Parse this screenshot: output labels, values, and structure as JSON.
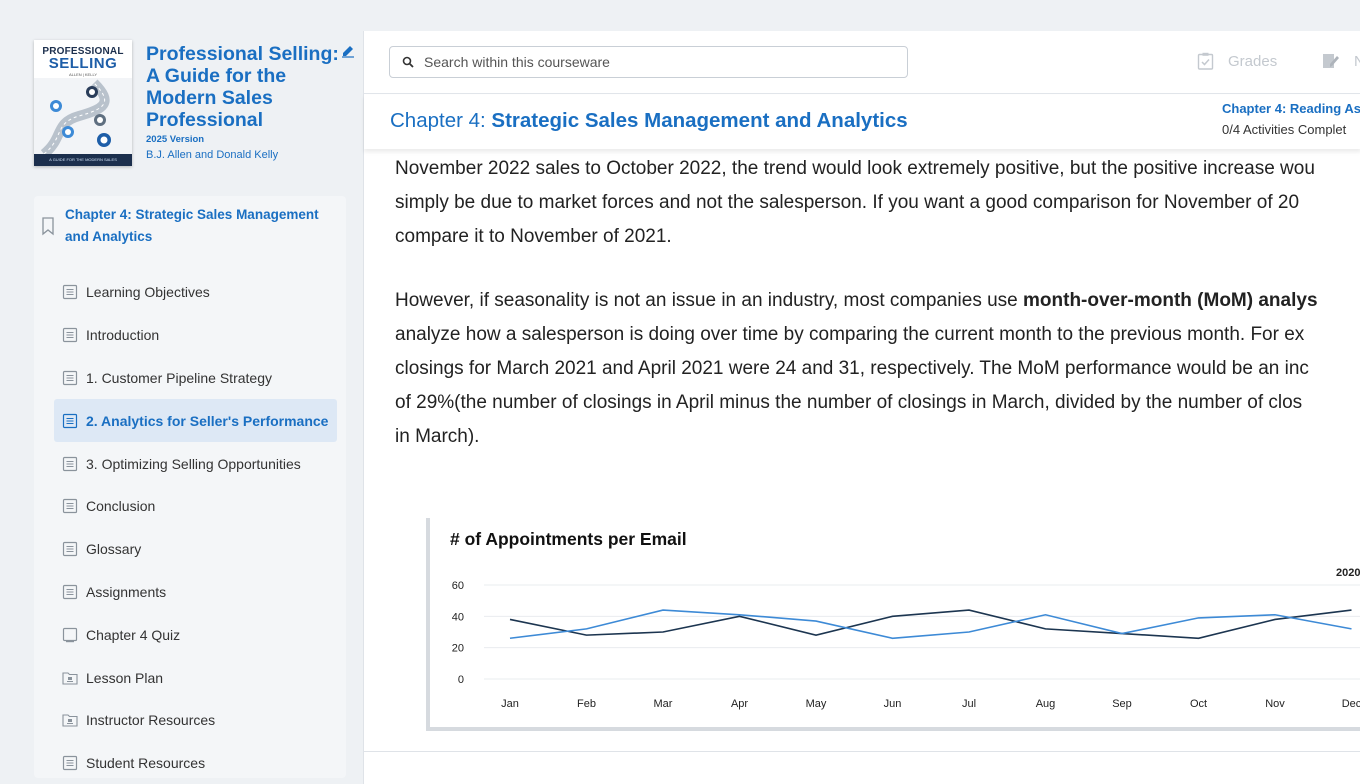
{
  "book": {
    "cover_title_line1": "PROFESSIONAL",
    "cover_title_line2": "SELLING",
    "cover_authors": "ALLEN | KELLY",
    "cover_band": "A GUIDE FOR THE MODERN SALES PROFESSIONAL",
    "title": "Professional Selling: A Guide for the Modern Sales Professional",
    "version": "2025 Version",
    "authors": "B.J. Allen and Donald Kelly",
    "edit_icon": "edit-pencil-icon"
  },
  "toc": {
    "chapter_title": "Chapter 4: Strategic Sales Management and Analytics",
    "items": [
      {
        "label": "Learning Objectives",
        "icon": "page-icon"
      },
      {
        "label": "Introduction",
        "icon": "page-icon"
      },
      {
        "label": "1. Customer Pipeline Strategy",
        "icon": "page-icon"
      },
      {
        "label": "2. Analytics for Seller's Performance",
        "icon": "page-icon",
        "active": true
      },
      {
        "label": "3. Optimizing Selling Opportunities",
        "icon": "page-icon"
      },
      {
        "label": "Conclusion",
        "icon": "page-icon"
      },
      {
        "label": "Glossary",
        "icon": "page-icon"
      },
      {
        "label": "Assignments",
        "icon": "page-icon"
      },
      {
        "label": "Chapter 4 Quiz",
        "icon": "quiz-icon"
      },
      {
        "label": "Lesson Plan",
        "icon": "folder-icon"
      },
      {
        "label": "Instructor Resources",
        "icon": "folder-icon"
      },
      {
        "label": "Student Resources",
        "icon": "page-icon"
      }
    ]
  },
  "search": {
    "placeholder": "Search within this courseware",
    "value": ""
  },
  "toolbar": {
    "grades_label": "Grades",
    "notes_label": "No"
  },
  "chapter": {
    "prefix": "Chapter 4: ",
    "title": "Strategic Sales Management and Analytics",
    "reading_title": "Chapter 4: Reading As",
    "reading_progress": "0/4 Activities Complet"
  },
  "content": {
    "p1_line1": "November 2022 sales to October 2022, the trend would look extremely positive, but the positive increase wou",
    "p1_line2": "simply be due to market forces and not the salesperson. If you want a good comparison for November of 20",
    "p1_line3": "compare it to November of 2021.",
    "p2_line1_a": "However, if seasonality is not an issue in an industry, most companies use ",
    "p2_line1_b": "month-over-month (MoM) analys",
    "p2_line2": "analyze how a salesperson is doing over time by comparing the current month to the previous month. For ex",
    "p2_line3": "closings for March 2021 and April 2021 were 24 and 31, respectively. The MoM performance would be an inc",
    "p2_line4": "of 29%(the number of closings in April minus the number of closings in March, divided by the number of clos",
    "p2_line5": "in March)."
  },
  "chart_data": {
    "type": "line",
    "title": "# of Appointments per Email",
    "legend_visible": "2020",
    "legend_placement": "top-right",
    "categories": [
      "Jan",
      "Feb",
      "Mar",
      "Apr",
      "May",
      "Jun",
      "Jul",
      "Aug",
      "Sep",
      "Oct",
      "Nov",
      "Dec"
    ],
    "yticks": [
      0,
      20,
      40,
      60
    ],
    "ylim": [
      0,
      60
    ],
    "grid": "horizontal",
    "series": [
      {
        "name": "",
        "color": "#1c3550",
        "values": [
          38,
          28,
          30,
          40,
          28,
          40,
          44,
          32,
          29,
          26,
          38,
          44
        ]
      },
      {
        "name": "",
        "color": "#3d8ad6",
        "values": [
          26,
          32,
          44,
          41,
          37,
          26,
          30,
          41,
          29,
          39,
          41,
          32
        ]
      }
    ]
  }
}
